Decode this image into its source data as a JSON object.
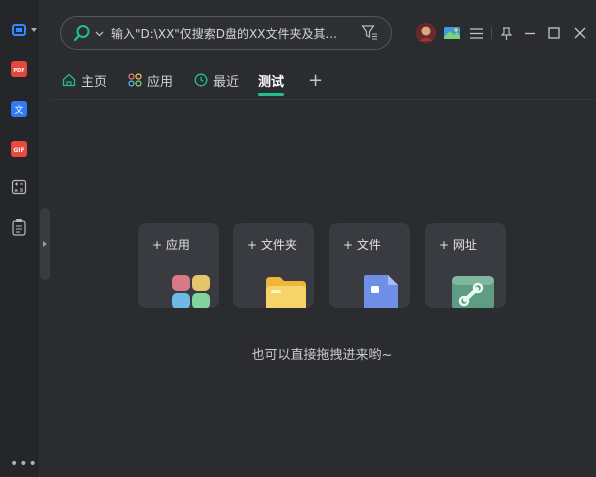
{
  "search": {
    "placeholder": "输入\"D:\\XX\"仅搜索D盘的XX文件夹及其..."
  },
  "tabs": [
    {
      "label": "主页"
    },
    {
      "label": "应用"
    },
    {
      "label": "最近"
    },
    {
      "label": "测试"
    }
  ],
  "add_tab": "+",
  "cards": [
    {
      "label": "应用"
    },
    {
      "label": "文件夹"
    },
    {
      "label": "文件"
    },
    {
      "label": "网址"
    }
  ],
  "plus": "+",
  "hint": "也可以直接拖拽进来哟~",
  "sidebar": {
    "more": "•••",
    "items": [
      {
        "icon": "screen-capture-icon"
      },
      {
        "icon": "pdf-icon"
      },
      {
        "icon": "translate-icon"
      },
      {
        "icon": "gif-icon"
      },
      {
        "icon": "calculator-icon"
      },
      {
        "icon": "notes-icon"
      }
    ]
  },
  "colors": {
    "accent": "#1fbf8f",
    "background": "#2b2c30",
    "card": "#3a3b40"
  }
}
